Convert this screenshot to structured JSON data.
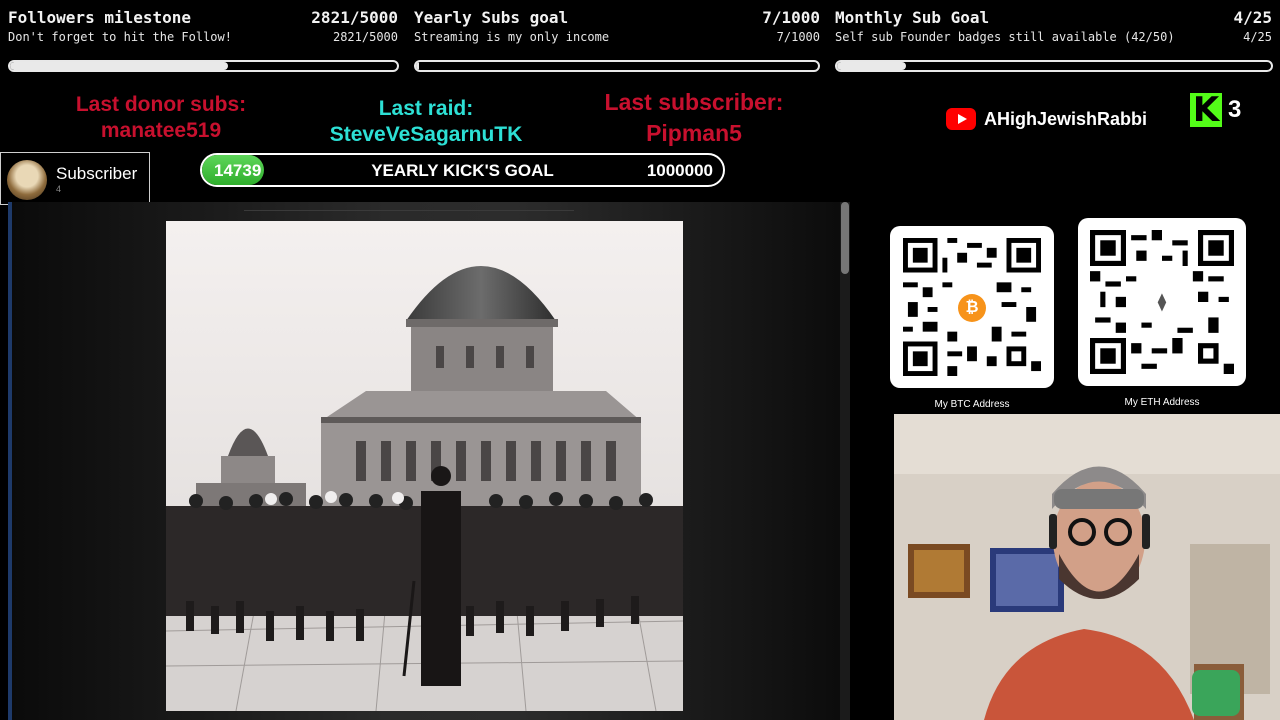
{
  "goals": [
    {
      "title": "Followers milestone",
      "count": "2821/5000",
      "subtitle": "Don't forget to hit the Follow!",
      "subcount": "2821/5000",
      "progress": 0.5642
    },
    {
      "title": "Yearly Subs goal",
      "count": "7/1000",
      "subtitle": "Streaming is my only income",
      "subcount": "7/1000",
      "progress": 0.007
    },
    {
      "title": "Monthly Sub Goal",
      "count": "4/25",
      "subtitle": "Self sub Founder badges still available (42/50)",
      "subcount": "4/25",
      "progress": 0.16
    }
  ],
  "events": {
    "donor_label": "Last donor subs:",
    "donor_name": "manatee519",
    "raid_label": "Last raid:",
    "raid_name": "SteveVeSagarnuTK",
    "sub_label": "Last subscriber:",
    "sub_name": "Pipman5"
  },
  "channel": {
    "youtube_name": "AHighJewishRabbi",
    "kick_count": "3"
  },
  "subscriber_card": {
    "label": "Subscriber",
    "count": "4"
  },
  "kick_goal": {
    "current": "14739",
    "title": "YEARLY KICK'S GOAL",
    "target": "1000000",
    "progress": 0.0147
  },
  "qr": {
    "btc_label": "My BTC Address",
    "eth_label": "My ETH Address"
  },
  "colors": {
    "accent_red": "#c8102e",
    "accent_cyan": "#2de0d5",
    "kick_green": "#53fc18",
    "youtube_red": "#ff0000"
  },
  "icons": [
    "youtube-icon",
    "kick-icon",
    "bitcoin-icon",
    "ethereum-icon",
    "avatar"
  ]
}
